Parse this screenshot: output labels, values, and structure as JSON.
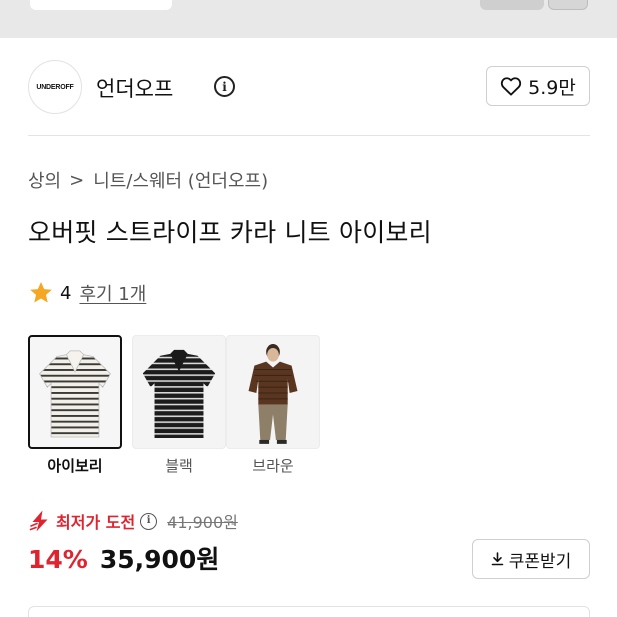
{
  "brand": {
    "logo_text": "UNDEROFF",
    "name": "언더오프",
    "like_count": "5.9만"
  },
  "breadcrumb": {
    "items": [
      "상의",
      "니트/스웨터 (언더오프)"
    ],
    "separator": ">"
  },
  "product": {
    "title": "오버핏 스트라이프 카라 니트 아이보리",
    "rating": "4",
    "review_link": "후기 1개"
  },
  "colors": {
    "options": [
      {
        "label": "아이보리",
        "selected": true
      },
      {
        "label": "블랙",
        "selected": false
      },
      {
        "label": "브라운",
        "selected": false
      }
    ]
  },
  "pricing": {
    "lowest_label": "최저가 도전",
    "original_price": "41,900원",
    "discount": "14%",
    "price": "35,900원",
    "coupon_label": "쿠폰받기"
  },
  "theme": {
    "accent_red": "#e0242f",
    "star_orange": "#f5a623",
    "text_dark": "#111111",
    "text_gray": "#555555"
  }
}
